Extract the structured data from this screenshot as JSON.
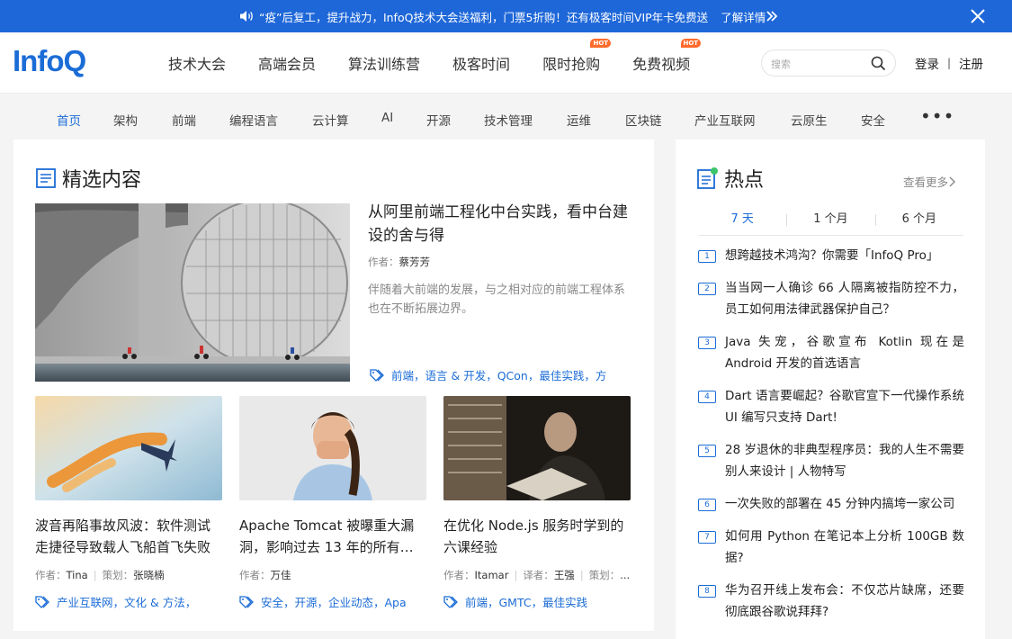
{
  "promo": {
    "text": "“疫”后复工，提升战力，InfoQ技术大会送福利，门票5折购！还有极客时间VIP年卡免费送",
    "link": "了解详情"
  },
  "header": {
    "logo_text": "Info",
    "logo_q": "Q",
    "nav": [
      {
        "label": "技术大会",
        "hot": ""
      },
      {
        "label": "高端会员",
        "hot": ""
      },
      {
        "label": "算法训练营",
        "hot": ""
      },
      {
        "label": "极客时间",
        "hot": ""
      },
      {
        "label": "限时抢购",
        "hot": "HOT"
      },
      {
        "label": "免费视频",
        "hot": "HOT"
      }
    ],
    "search_placeholder": "搜索",
    "login": "登录",
    "divider": "|",
    "register": "注册"
  },
  "categories": [
    "首页",
    "架构",
    "前端",
    "编程语言",
    "云计算",
    "AI",
    "开源",
    "技术管理",
    "运维",
    "区块链",
    "产业互联网",
    "云原生",
    "安全"
  ],
  "featured": {
    "section_title": "精选内容",
    "main": {
      "title": "从阿里前端工程化中台实践，看中台建设的舍与得",
      "author_label": "作者：",
      "author": "蔡芳芳",
      "desc": "伴随着大前端的发展，与之相对应的前端工程体系也在不断拓展边界。",
      "tags": "前端，语言 & 开发，QCon，最佳实践，方"
    },
    "cards": [
      {
        "title": "波音再陷事故风波：软件测试走捷径导致载人飞船首飞失败",
        "meta": [
          {
            "label": "作者：",
            "value": "Tina"
          },
          {
            "label": "策划：",
            "value": "张晓楠"
          }
        ],
        "tags": "产业互联网，文化 & 方法，"
      },
      {
        "title": "Apache Tomcat 被曝重大漏洞，影响过去 13 年的所有…",
        "meta": [
          {
            "label": "作者：",
            "value": "万佳"
          }
        ],
        "tags": "安全，开源，企业动态，Apa"
      },
      {
        "title": "在优化 Node.js 服务时学到的六课经验",
        "meta": [
          {
            "label": "作者：",
            "value": "Itamar"
          },
          {
            "label": "译者：",
            "value": "王强"
          },
          {
            "label": "策划：",
            "value": "..."
          }
        ],
        "tags": "前端，GMTC，最佳实践"
      }
    ]
  },
  "hot": {
    "section_title": "热点",
    "see_more": "查看更多",
    "tabs": [
      "7 天",
      "1 个月",
      "6 个月"
    ],
    "items": [
      {
        "num": "1",
        "text": "想跨越技术鸿沟？你需要「InfoQ Pro」"
      },
      {
        "num": "2",
        "text": "当当网一人确诊 66 人隔离被指防控不力，员工如何用法律武器保护自己？"
      },
      {
        "num": "3",
        "text": "Java 失宠，谷歌宣布 Kotlin 现在是 Android 开发的首选语言"
      },
      {
        "num": "4",
        "text": "Dart 语言要崛起？谷歌官宣下一代操作系统 UI 编写只支持 Dart!"
      },
      {
        "num": "5",
        "text": "28 岁退休的非典型程序员：我的人生不需要别人来设计 | 人物特写"
      },
      {
        "num": "6",
        "text": "一次失败的部署在 45 分钟内搞垮一家公司"
      },
      {
        "num": "7",
        "text": "如何用 Python 在笔记本上分析 100GB 数据?"
      },
      {
        "num": "8",
        "text": "华为召开线上发布会：不仅芯片缺席，还要彻底跟谷歌说拜拜?"
      }
    ]
  }
}
